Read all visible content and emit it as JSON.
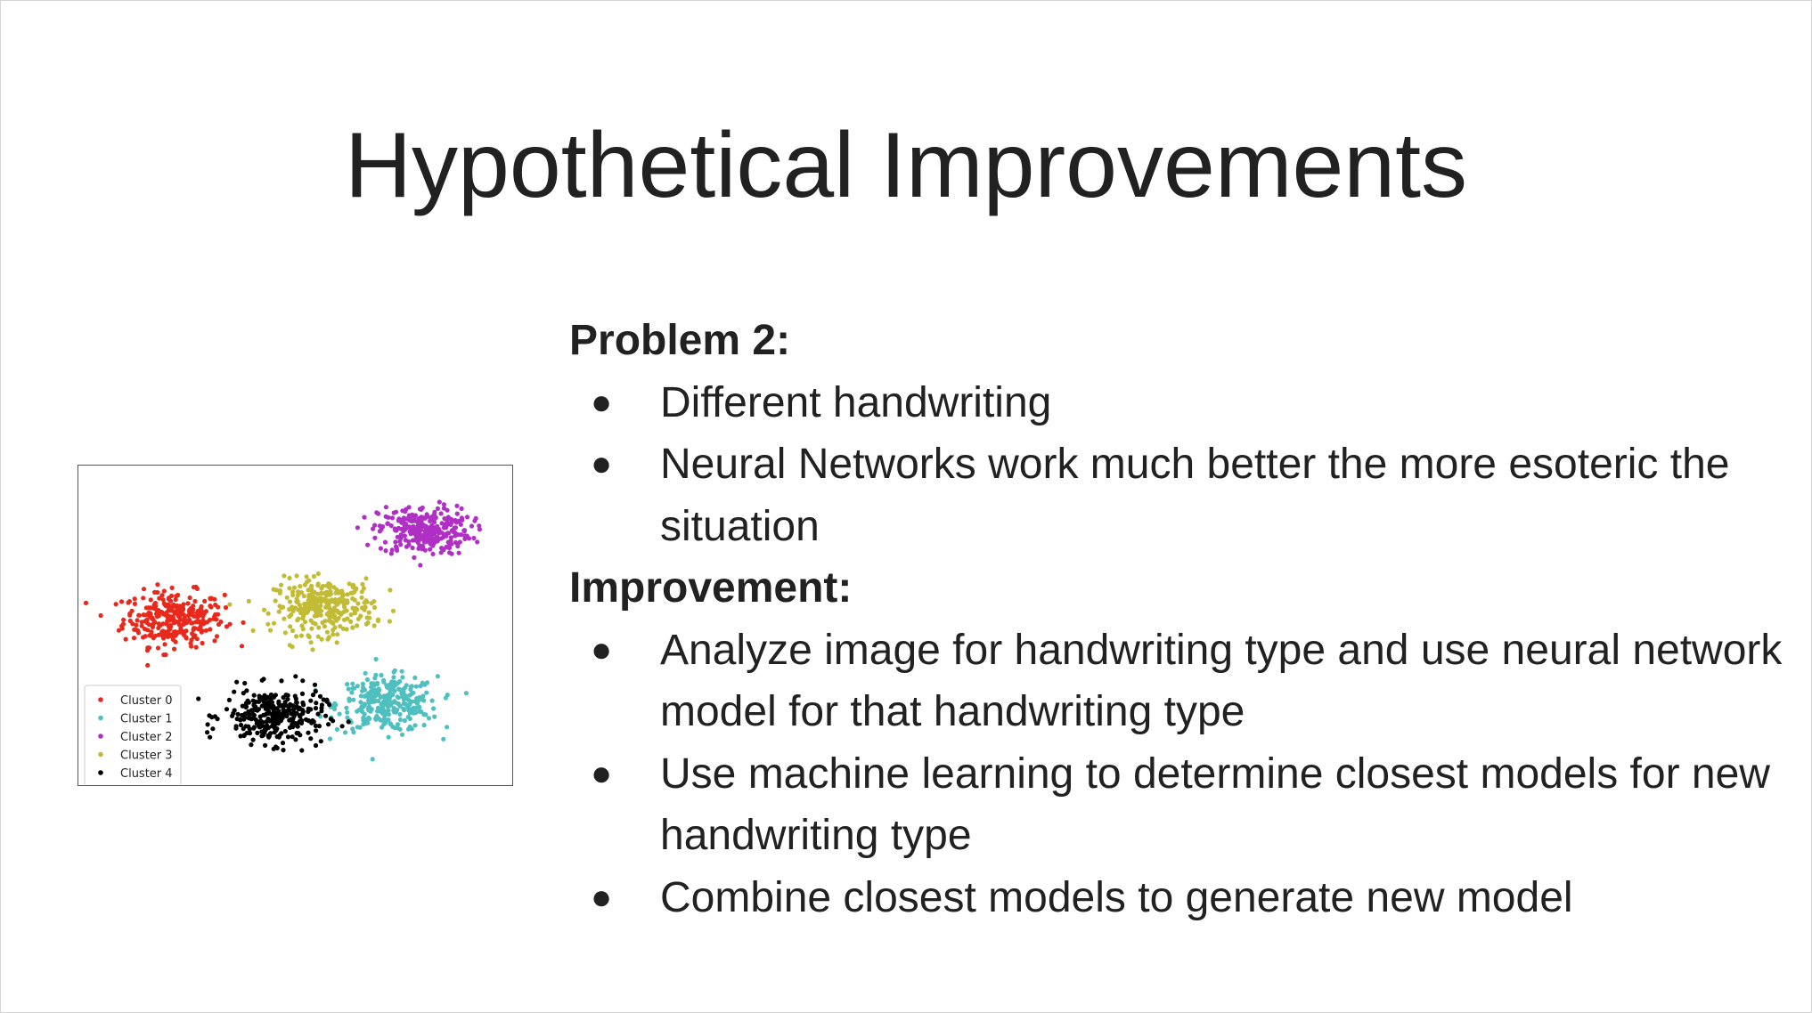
{
  "slide": {
    "title": "Hypothetical Improvements"
  },
  "sections": [
    {
      "heading": "Problem 2:",
      "bullets": [
        "Different handwriting",
        "Neural Networks work much better the more esoteric the situation"
      ]
    },
    {
      "heading": "Improvement:",
      "bullets": [
        "Analyze image for handwriting type and use neural network model for that handwriting type",
        "Use machine learning to determine closest models for new handwriting type",
        "Combine closest models to generate new model"
      ]
    }
  ],
  "bullet_glyph": "●",
  "chart_data": {
    "type": "scatter",
    "title": "",
    "xlabel": "",
    "ylabel": "",
    "grid": false,
    "axes_ticks": false,
    "xlim": [
      0,
      10
    ],
    "ylim": [
      0,
      10
    ],
    "legend": {
      "placement": "bottom-left",
      "entries": [
        "Cluster 0",
        "Cluster 1",
        "Cluster 2",
        "Cluster 3",
        "Cluster 4"
      ]
    },
    "series": [
      {
        "name": "Cluster 0",
        "color": "#e8291c",
        "center": [
          2.1,
          5.2
        ],
        "spread": [
          0.6,
          0.45
        ],
        "count": 300
      },
      {
        "name": "Cluster 1",
        "color": "#4fbfc0",
        "center": [
          7.2,
          2.4
        ],
        "spread": [
          0.6,
          0.45
        ],
        "count": 300
      },
      {
        "name": "Cluster 2",
        "color": "#b02fc4",
        "center": [
          8.1,
          8.1
        ],
        "spread": [
          0.55,
          0.4
        ],
        "count": 300
      },
      {
        "name": "Cluster 3",
        "color": "#c2bb35",
        "center": [
          5.7,
          5.6
        ],
        "spread": [
          0.6,
          0.45
        ],
        "count": 300
      },
      {
        "name": "Cluster 4",
        "color": "#000000",
        "center": [
          4.5,
          2.0
        ],
        "spread": [
          0.6,
          0.45
        ],
        "count": 300
      }
    ]
  }
}
